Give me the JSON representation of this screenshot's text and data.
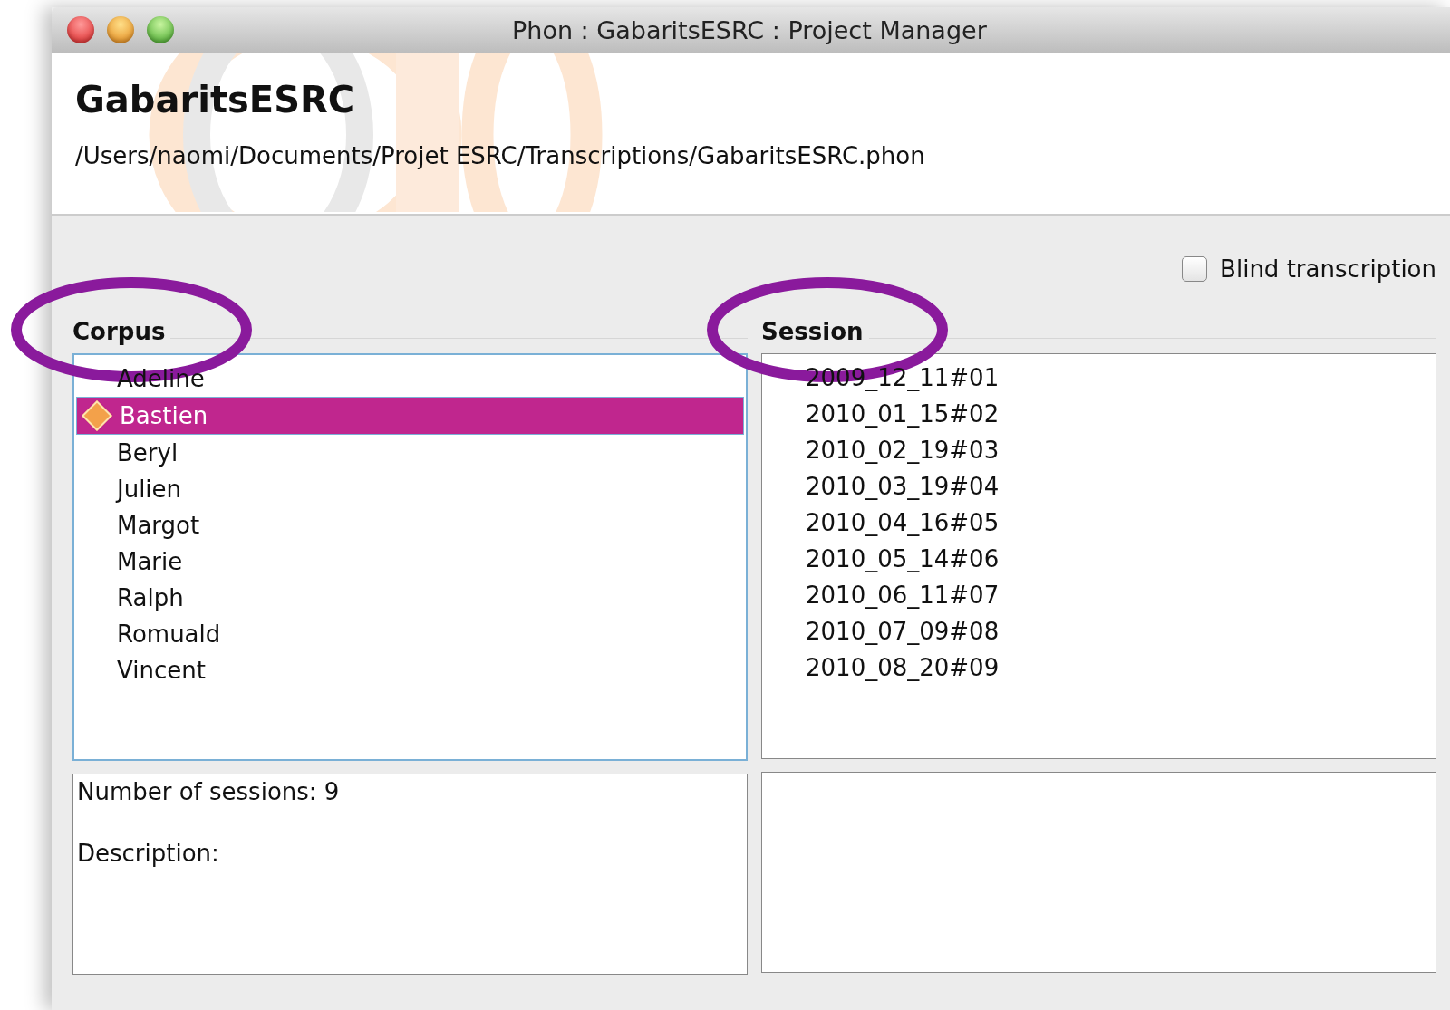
{
  "window": {
    "title": "Phon : GabaritsESRC : Project Manager"
  },
  "project": {
    "name": "GabaritsESRC",
    "path": "/Users/naomi/Documents/Projet ESRC/Transcriptions/GabaritsESRC.phon"
  },
  "blind_transcription": {
    "label": "Blind transcription",
    "checked": false
  },
  "corpus": {
    "heading": "Corpus",
    "circled": true,
    "items": [
      {
        "label": "Adeline",
        "selected": false
      },
      {
        "label": "Bastien",
        "selected": true
      },
      {
        "label": "Beryl",
        "selected": false
      },
      {
        "label": "Julien",
        "selected": false
      },
      {
        "label": "Margot",
        "selected": false
      },
      {
        "label": "Marie",
        "selected": false
      },
      {
        "label": "Ralph",
        "selected": false
      },
      {
        "label": "Romuald",
        "selected": false
      },
      {
        "label": "Vincent",
        "selected": false
      }
    ],
    "info": [
      "Number of sessions: 9",
      "Description:"
    ]
  },
  "session": {
    "heading": "Session",
    "circled": true,
    "items": [
      {
        "label": "2009_12_11#01",
        "selected": false
      },
      {
        "label": "2010_01_15#02",
        "selected": false
      },
      {
        "label": "2010_02_19#03",
        "selected": false
      },
      {
        "label": "2010_03_19#04",
        "selected": false
      },
      {
        "label": "2010_04_16#05",
        "selected": false
      },
      {
        "label": "2010_05_14#06",
        "selected": false
      },
      {
        "label": "2010_06_11#07",
        "selected": false
      },
      {
        "label": "2010_07_09#08",
        "selected": false
      },
      {
        "label": "2010_08_20#09",
        "selected": false
      }
    ]
  }
}
